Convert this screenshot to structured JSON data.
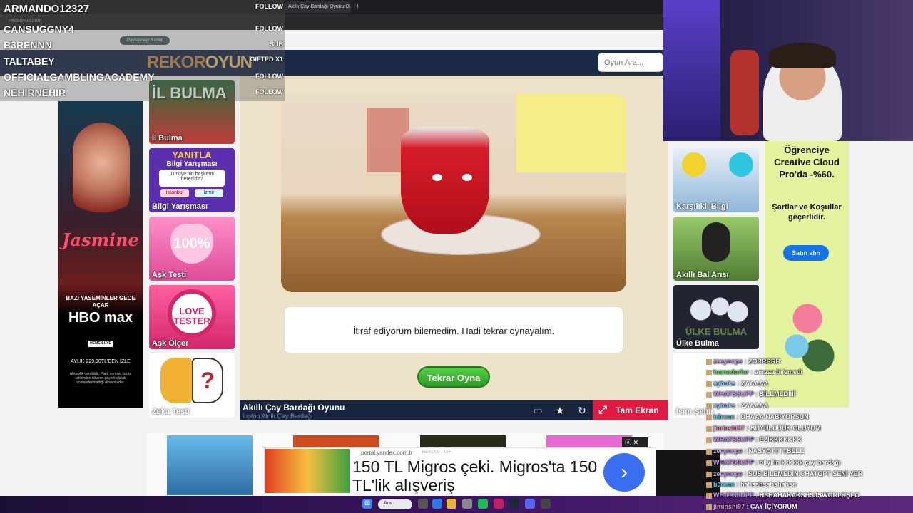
{
  "browser": {
    "tab_title": "Akıllı Çay Bardağı Oyunu O...",
    "new_tab": "+",
    "url": "rekoroyun.com",
    "share_label": "Paylaşmayı durdur"
  },
  "site": {
    "logo_a": "REKOR",
    "logo_b": "OYUN",
    "search_placeholder": "Oyun Ara..."
  },
  "left_ad": {
    "title": "Jasmine",
    "tagline": "BAZI YASEMİNLER GECE AÇAR",
    "brand": "HBO max",
    "join": "HEMEN ÜYE OL",
    "price": "AYLIK 229,90TL'DEN İZLE",
    "fine": "Abonelik gereklidir. Plan, sonraki fatura tarihinden itibaren geçerli olarak sonlandırılmadığı devam eder."
  },
  "left_games": [
    {
      "label": "İl Bulma",
      "art": "İL BULMA"
    },
    {
      "label": "Bilgi Yarışması",
      "art": "YANITLA",
      "sub": "Bilgi Yarışması",
      "q": "Türkiye'nin başkenti neresidir?",
      "o1": "İstanbul",
      "o2": "İzmir"
    },
    {
      "label": "Aşk Testi",
      "art": "100%"
    },
    {
      "label": "Aşk Ölçer",
      "art": "LOVE TESTER"
    },
    {
      "label": "Zeka Testi",
      "art": "?"
    }
  ],
  "game": {
    "message": "İtiraf ediyorum bilemedim. Hadi tekrar oynayalım.",
    "replay": "Tekrar Oyna",
    "name": "Akıllı Çay Bardağı Oyunu",
    "sub": "Lipton Akıllı Çay Bardağı",
    "fullscreen": "Tam Ekran"
  },
  "right_games": [
    {
      "label": "Karşılıklı Bilgi"
    },
    {
      "label": "Akıllı Bal Arısı"
    },
    {
      "label": "Ülke Bulma",
      "art": "ÜLKE BULMA"
    },
    {
      "label": "İsim Şehir"
    }
  ],
  "right_ad": {
    "headline": "Öğrenciye Creative Cloud Pro'da -%60.",
    "terms": "Şartlar ve Koşullar geçerlidir.",
    "button": "Satın alın"
  },
  "yandex_ad": {
    "source": "portal.yandex.com.tr",
    "tag": "REKLAM · 16+",
    "headline": "150 TL Migros çeki. Migros'ta 150 TL'lik alışveriş",
    "arrow": "›",
    "close": "ⓐ ✕"
  },
  "taskbar": {
    "search": "Ara"
  },
  "stream_follows": [
    {
      "name": "ARMANDO12327",
      "tag": "FOLLOW"
    },
    {
      "name": "CANSUGGNY4",
      "tag": "FOLLOW"
    },
    {
      "name": "B3RENNN",
      "tag": "SUB"
    },
    {
      "name": "TALTABEY",
      "tag": "GIFTED X1"
    },
    {
      "name": "OFFICIALGAMBLINGACADEMY",
      "tag": "FOLLOW"
    },
    {
      "name": "NEHIRNEHIR",
      "tag": "FOLLOW"
    }
  ],
  "chat": [
    {
      "user": "zeeynope",
      "text": "ZORRRRR",
      "color": "#c58cf5"
    },
    {
      "user": "tuanadurlur",
      "text": "amaaa bilemedi",
      "color": "#6bd16b"
    },
    {
      "user": "aybuks",
      "text": "ZAAAAA",
      "color": "#8ec4ff"
    },
    {
      "user": "WHATSSUPP",
      "text": "BİLEMEDİİİİ",
      "color": "#c58cf5"
    },
    {
      "user": "aybuks",
      "text": "ZAAAAA",
      "color": "#8ec4ff"
    },
    {
      "user": "b3renn",
      "text": "OHAAA NABIYORSUN",
      "color": "#4ec9e0"
    },
    {
      "user": "jiminshi97",
      "text": "BÜYÜLÜÜÜK OLUYUM",
      "color": "#f09bd0"
    },
    {
      "user": "WHATSSUPP",
      "text": "EZİKKKKKKK",
      "color": "#c58cf5"
    },
    {
      "user": "zeeynope",
      "text": "NASYOTTTTBEEE",
      "color": "#c58cf5"
    },
    {
      "user": "WHATSSUPP",
      "text": "bilyilin kkkkkk çay bardağı",
      "color": "#c58cf5"
    },
    {
      "user": "zeeynope",
      "text": "SUS BİLEMEDİN CHATGPT SENİ YER",
      "color": "#c58cf5"
    },
    {
      "user": "b3renn",
      "text": "hahsahsahshahsa",
      "color": "#4ec9e0"
    },
    {
      "user": "WHATSSUPP",
      "text": "HSHAHAKAKSHSJŞWGRLKŞEO",
      "color": "#c58cf5"
    },
    {
      "user": "jiminshi97",
      "text": "ÇAY İÇİYORUM",
      "color": "#f09bd0"
    }
  ]
}
